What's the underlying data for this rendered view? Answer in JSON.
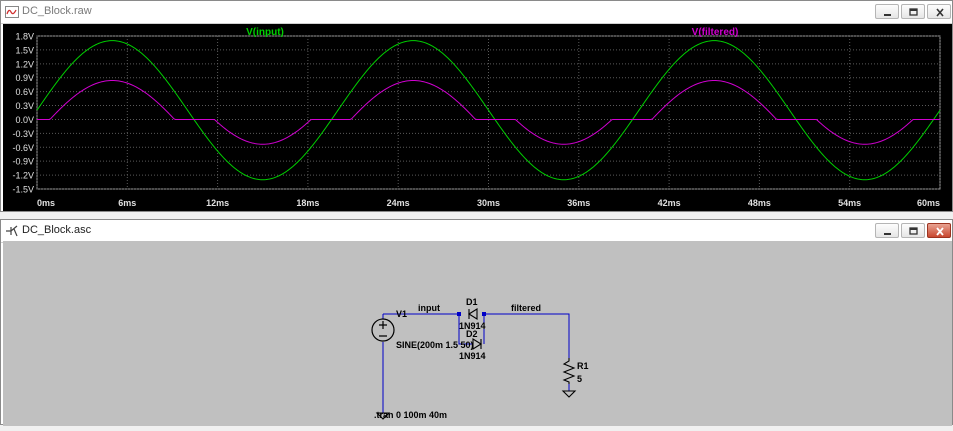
{
  "plot_window": {
    "title": "DC_Block.raw",
    "buttons": {
      "minimize": "minimize",
      "restore": "restore",
      "close": "close"
    }
  },
  "schematic_window": {
    "title": "DC_Block.asc",
    "buttons": {
      "minimize": "minimize",
      "restore": "restore",
      "close": "close"
    }
  },
  "colors": {
    "plot_background": "#000000",
    "input_trace": "#00d000",
    "filtered_trace": "#d000d0",
    "grid": "#5a5a5a",
    "axis_text": "#e0e0e0",
    "wire": "#0000c8",
    "schematic_background": "#c0c0c0"
  },
  "chart_data": {
    "type": "line",
    "xlabel": "",
    "ylabel": "",
    "x_ticks": [
      "0ms",
      "6ms",
      "12ms",
      "18ms",
      "24ms",
      "30ms",
      "36ms",
      "42ms",
      "48ms",
      "54ms",
      "60ms"
    ],
    "y_ticks": [
      "1.8V",
      "1.5V",
      "1.2V",
      "0.9V",
      "0.6V",
      "0.3V",
      "0.0V",
      "-0.3V",
      "-0.6V",
      "-0.9V",
      "-1.2V",
      "-1.5V"
    ],
    "xlim": [
      0,
      60
    ],
    "ylim": [
      -1.5,
      1.8
    ],
    "grid": true,
    "series": [
      {
        "name": "V(input)",
        "color": "#00d000",
        "offset": 0.2,
        "amplitude": 1.5,
        "freq_hz": 50
      },
      {
        "name": "V(filtered)",
        "color": "#d000d0",
        "offset": -0.045,
        "amplitude": 0.84,
        "dead_zone": 0.6,
        "freq_hz": 50
      }
    ]
  },
  "schematic": {
    "source_ref": "V1",
    "source_value": "SINE(200m 1.5 50)",
    "net_input": "input",
    "net_filtered": "filtered",
    "diode1_ref": "D1",
    "diode1_model": "1N914",
    "diode2_ref": "D2",
    "diode2_model": "1N914",
    "resistor_ref": "R1",
    "resistor_value": "5",
    "directive": ".tran 0 100m 40m"
  }
}
